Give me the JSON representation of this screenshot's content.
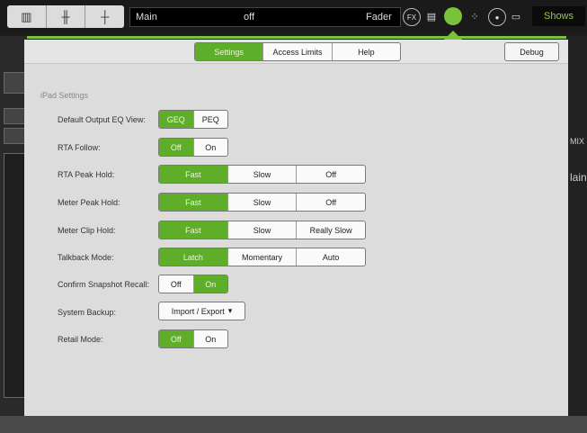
{
  "topbar": {
    "channel": "Main",
    "state": "off",
    "mode": "Fader",
    "fx_label": "FX",
    "shows_label": "Shows"
  },
  "background": {
    "right_mix": "MIX",
    "right_main": "lain"
  },
  "tabs": [
    {
      "label": "Settings",
      "active": true
    },
    {
      "label": "Access Limits",
      "active": false
    },
    {
      "label": "Help",
      "active": false
    }
  ],
  "debug_label": "Debug",
  "section_title": "iPad Settings",
  "settings": [
    {
      "label": "Default Output EQ View:",
      "options": [
        "GEQ",
        "PEQ"
      ],
      "selected": 0
    },
    {
      "label": "RTA Follow:",
      "options": [
        "Off",
        "On"
      ],
      "selected": 0
    },
    {
      "label": "RTA Peak Hold:",
      "options": [
        "Fast",
        "Slow",
        "Off"
      ],
      "selected": 0
    },
    {
      "label": "Meter Peak Hold:",
      "options": [
        "Fast",
        "Slow",
        "Off"
      ],
      "selected": 0
    },
    {
      "label": "Meter Clip Hold:",
      "options": [
        "Fast",
        "Slow",
        "Really Slow"
      ],
      "selected": 0
    },
    {
      "label": "Talkback Mode:",
      "options": [
        "Latch",
        "Momentary",
        "Auto"
      ],
      "selected": 0
    },
    {
      "label": "Confirm Snapshot Recall:",
      "options": [
        "Off",
        "On"
      ],
      "selected": 1
    },
    {
      "label": "System Backup:",
      "dropdown": "Import / Export"
    },
    {
      "label": "Retail Mode:",
      "options": [
        "Off",
        "On"
      ],
      "selected": 0
    }
  ],
  "colors": {
    "accent": "#5fae2a",
    "topbar": "#1a1a1a",
    "panel": "#dcdcdc"
  }
}
